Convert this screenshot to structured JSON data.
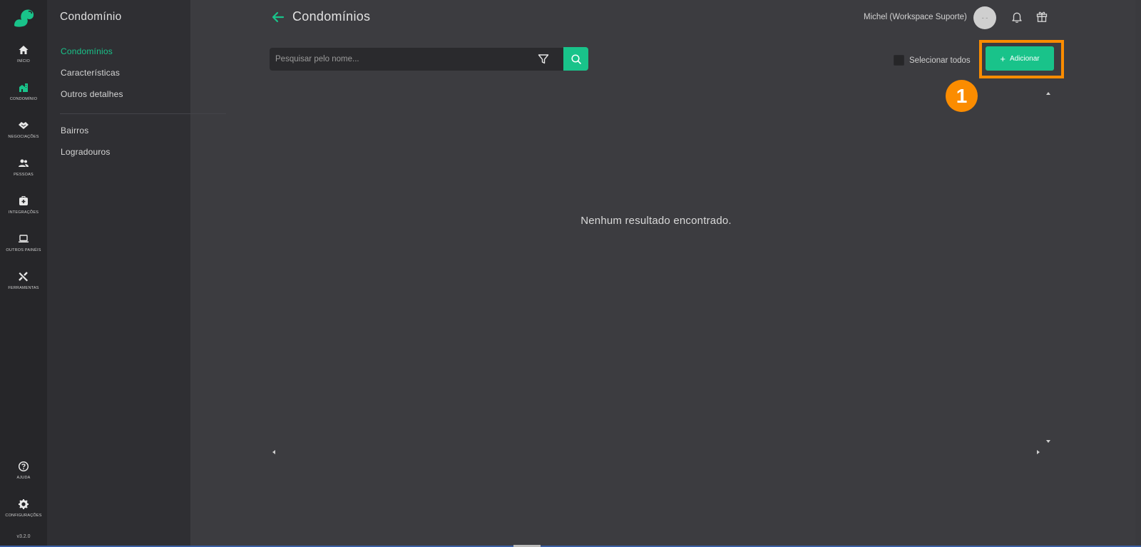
{
  "rail": {
    "items": [
      {
        "label": "Início",
        "icon": "home-icon"
      },
      {
        "label": "Condomínio",
        "icon": "building-icon"
      },
      {
        "label": "Negociações",
        "icon": "handshake-icon"
      },
      {
        "label": "Pessoas",
        "icon": "people-icon"
      },
      {
        "label": "Integrações",
        "icon": "integration-icon"
      },
      {
        "label": "Outros painéis",
        "icon": "laptop-icon"
      },
      {
        "label": "Ferramentas",
        "icon": "tools-icon"
      }
    ],
    "help": {
      "label": "Ajuda",
      "icon": "help-icon"
    },
    "settings": {
      "label": "Configurações",
      "icon": "gear-icon"
    },
    "version": "v3.2.0"
  },
  "subnav": {
    "title": "Condomínio",
    "items": [
      "Condomínios",
      "Características",
      "Outros detalhes",
      "Bairros",
      "Logradouros"
    ]
  },
  "header": {
    "title": "Condomínios",
    "user": "Michel (Workspace Suporte)",
    "avatar_text": "- -"
  },
  "search": {
    "placeholder": "Pesquisar pelo nome..."
  },
  "toolbar": {
    "select_all": "Selecionar todos",
    "add_label": "Adicionar",
    "add_symbol": "+"
  },
  "annotation": {
    "step": "1"
  },
  "main": {
    "empty_message": "Nenhum resultado encontrado."
  },
  "colors": {
    "accent": "#19c38a",
    "highlight": "#fb8c00",
    "background": "#3c3c40",
    "sidebar": "#262629",
    "subnav": "#2f2f33"
  }
}
